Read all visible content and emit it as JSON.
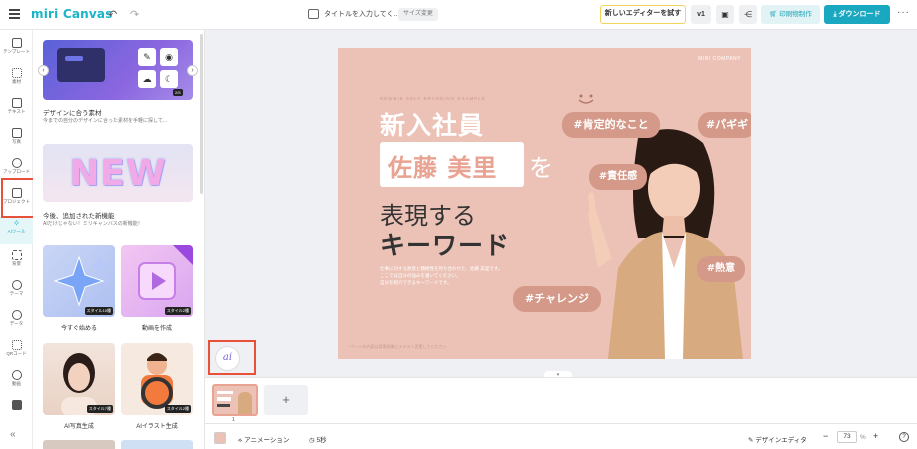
{
  "app": {
    "logo": "miri Canvas"
  },
  "header": {
    "doc_title": "タイトルを入力してく...",
    "size_change": "サイズ変更",
    "try_new_editor": "新しいエディターを試す",
    "version": "v1",
    "print_label": "印刷物制作",
    "download_label": "ダウンロード",
    "undo_glyph": "↶",
    "redo_glyph": "↷",
    "more_glyph": "···"
  },
  "sidebar": {
    "items": [
      {
        "label": "テンプレート",
        "icon": "template-icon"
      },
      {
        "label": "素材",
        "icon": "elements-icon"
      },
      {
        "label": "テキスト",
        "icon": "text-icon"
      },
      {
        "label": "写真",
        "icon": "photo-icon"
      },
      {
        "label": "アップロード",
        "icon": "upload-icon"
      },
      {
        "label": "プロジェクト",
        "icon": "project-icon"
      },
      {
        "label": "AIツール",
        "icon": "ai-tool-icon"
      },
      {
        "label": "背景",
        "icon": "background-icon"
      },
      {
        "label": "テーマ",
        "icon": "theme-icon"
      },
      {
        "label": "データ",
        "icon": "data-icon"
      },
      {
        "label": "QRコード",
        "icon": "qr-icon"
      },
      {
        "label": "動画",
        "icon": "video-icon"
      },
      {
        "label": "",
        "icon": "book-icon"
      }
    ],
    "collapse_glyph": "«"
  },
  "panel": {
    "section1_title": "デザインに合う素材",
    "section1_desc": "今までの自分のデザインに合った素材を手軽に探して...",
    "banner1_badge": "2/5",
    "section2_title": "今後、追加された新機能",
    "section2_desc": "AIだけじゃない！ミリキャンバスの新機能！",
    "banner2_text": "NEW",
    "cards": [
      {
        "label": "今すぐ始める",
        "tag": "スタイル10種"
      },
      {
        "label": "動画を作成",
        "tag": "スタイル2種"
      },
      {
        "label": "AI写真生成",
        "tag": "スタイル7種"
      },
      {
        "label": "AIイラスト生成",
        "tag": "スタイル2種"
      }
    ]
  },
  "slide": {
    "company": "MIRI COMPANY",
    "subtitle": "NEWBIE SELF BRANDING EXAMPLE",
    "heading1": "新入社員",
    "name": "佐藤 美里",
    "particle": "を",
    "heading3": "表現する",
    "heading4": "キーワード",
    "body_lines": [
      "仕事に対する熱意と積極性を持ち合わせた、佐藤 美里です。",
      "ここでは自分の強みを書いてください。",
      "自分を紹介できるキーワードです。"
    ],
    "hashtags": [
      "#肯定的なこと",
      "#パギギ",
      "#責任感",
      "#熱意",
      "#チャレンジ"
    ],
    "footer": "* ページの内容は背景画像とテキスト変更してください"
  },
  "ai_button": "ai",
  "pages": {
    "thumb_number": "1",
    "add_glyph": "+"
  },
  "bottom": {
    "animation": "アニメーション",
    "duration": "5秒",
    "design_editor": "デザインエディタ",
    "zoom": "73",
    "zoom_unit": "%",
    "minus": "−",
    "plus": "+",
    "help": "?"
  },
  "colors": {
    "brand": "#18b4c8",
    "slide_bg": "#ecc2b6",
    "hashtag_bg": "#d49989",
    "highlight": "#e8503a",
    "download_bg": "#1aa8c0"
  }
}
